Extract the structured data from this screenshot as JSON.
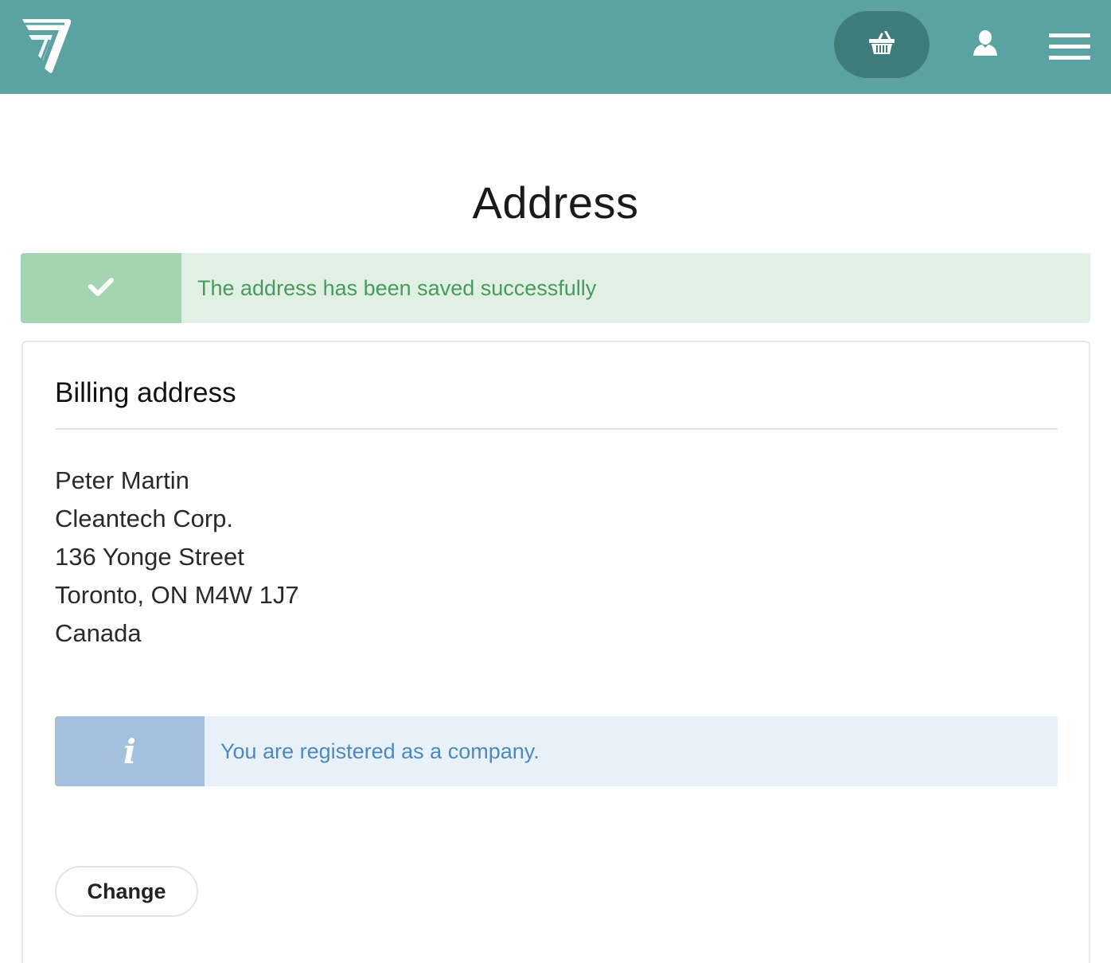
{
  "header": {
    "logo_icon": "brand-logo-7-icon",
    "cart_icon": "basket-icon",
    "user_icon": "user-icon",
    "menu_icon": "hamburger-menu-icon",
    "colors": {
      "bar": "#5ba3a3",
      "cart_button": "#3f7c7c"
    }
  },
  "page": {
    "title": "Address"
  },
  "success_alert": {
    "icon": "check-icon",
    "message": "The address has been saved successfully",
    "colors": {
      "background": "#e0f0e5",
      "icon_box": "#a5d4b2",
      "text": "#4a9a5c"
    }
  },
  "billing": {
    "title": "Billing address",
    "lines": [
      "Peter Martin",
      "Cleantech Corp.",
      "136 Yonge Street",
      "Toronto, ON M4W 1J7",
      "Canada"
    ]
  },
  "info_alert": {
    "icon": "info-icon",
    "icon_glyph": "i",
    "message": "You are registered as a company.",
    "colors": {
      "background": "#e9f1f8",
      "icon_box": "#a3c1dc",
      "text": "#4b8ac0"
    }
  },
  "actions": {
    "change_label": "Change"
  }
}
